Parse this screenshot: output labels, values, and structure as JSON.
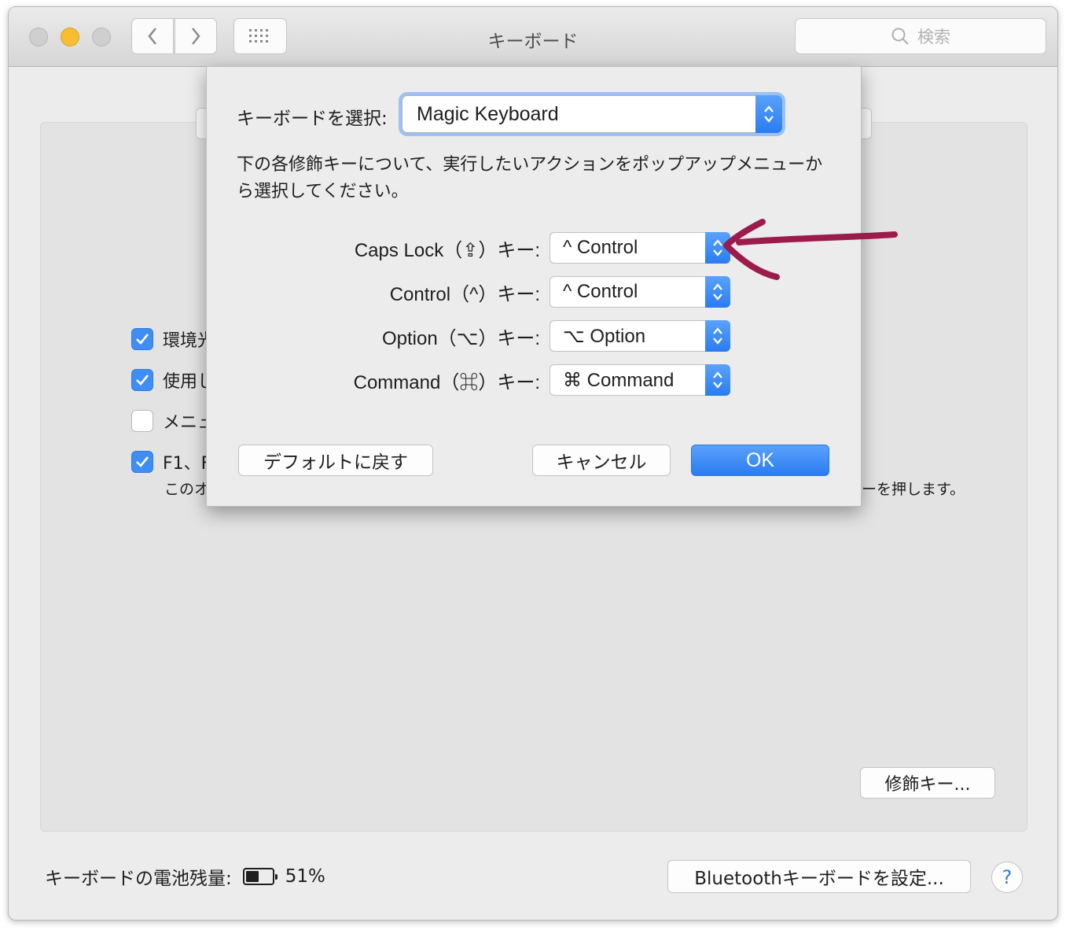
{
  "window": {
    "title": "キーボード",
    "search_placeholder": "検索"
  },
  "background": {
    "checkboxes": [
      {
        "label": "環境光",
        "checked": true
      },
      {
        "label": "使用し",
        "checked": true
      },
      {
        "label": "メニュ",
        "checked": false
      },
      {
        "label": "F1、F",
        "checked": true
      }
    ],
    "note_left": "このオ",
    "note_right": "ーを押します。",
    "modifier_button": "修飾キー...",
    "battery_label": "キーボードの電池残量:",
    "battery_level": 0.51,
    "battery_percent": "51%",
    "bluetooth_button": "Bluetoothキーボードを設定...",
    "help_button": "?"
  },
  "sheet": {
    "keyboard_label": "キーボードを選択:",
    "keyboard_value": "Magic Keyboard",
    "instructions": "下の各修飾キーについて、実行したいアクションをポップアップメニューから選択してください。",
    "modifiers": [
      {
        "label": "Caps Lock（⇪）キー:",
        "value": "^ Control"
      },
      {
        "label": "Control（^）キー:",
        "value": "^ Control"
      },
      {
        "label": "Option（⌥）キー:",
        "value": "⌥ Option"
      },
      {
        "label": "Command（⌘）キー:",
        "value": "⌘ Command"
      }
    ],
    "default_button": "デフォルトに戻す",
    "cancel_button": "キャンセル",
    "ok_button": "OK"
  },
  "colors": {
    "accent": "#2a7cf1",
    "annotation_arrow": "#9c1b4d",
    "minimize": "#f6be30"
  }
}
